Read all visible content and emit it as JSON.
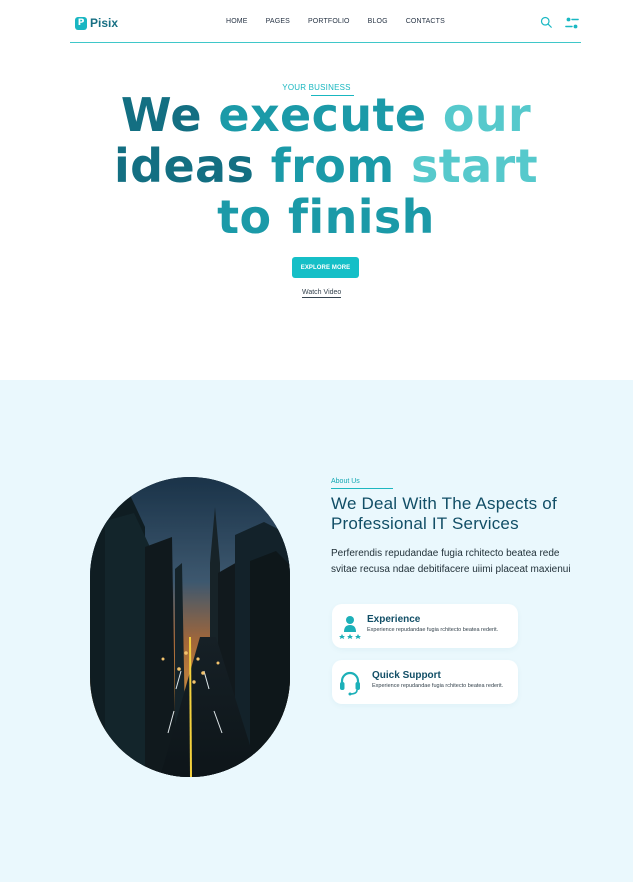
{
  "header": {
    "logo_mark": "P",
    "logo": "Pisix",
    "nav": [
      "HOME",
      "PAGES",
      "PORTFOLIO",
      "BLOG",
      "CONTACTS"
    ],
    "search_icon": "search-icon",
    "settings_icon": "settings-icon"
  },
  "hero": {
    "eyebrow": "YOUR BUSINESS",
    "title": {
      "line1_a": "We",
      "line1_b": " execute",
      "line1_c": " our",
      "line2_a": "ideas",
      "line2_b": " from",
      "line2_c": " start",
      "line3_a": "to",
      "line3_b": " finish"
    },
    "cta": "EXPLORE MORE",
    "watch_video": "Watch Video"
  },
  "about": {
    "label": "About Us",
    "title": "We Deal With The Aspects of Professional IT Services",
    "description": "Perferendis repudandae fugia rchitecto beatea rede svitae recusa ndae debitifacere uiimi placeat maxienui",
    "cards": [
      {
        "title": "Experience",
        "text": "Experience repudandae fugia rchitecto beatea rederit.",
        "icon": "user-icon"
      },
      {
        "title": "Quick Support",
        "text": "Experience repudandae fugia rchitecto beatea rederit.",
        "icon": "headset-icon"
      }
    ]
  },
  "colors": {
    "brand": "#19b6c2",
    "title_dark": "#136f82",
    "title_mid": "#1b9aa8",
    "title_light": "#56c9cc",
    "section_bg": "#eaf8fd",
    "heading_dark": "#114e66"
  }
}
